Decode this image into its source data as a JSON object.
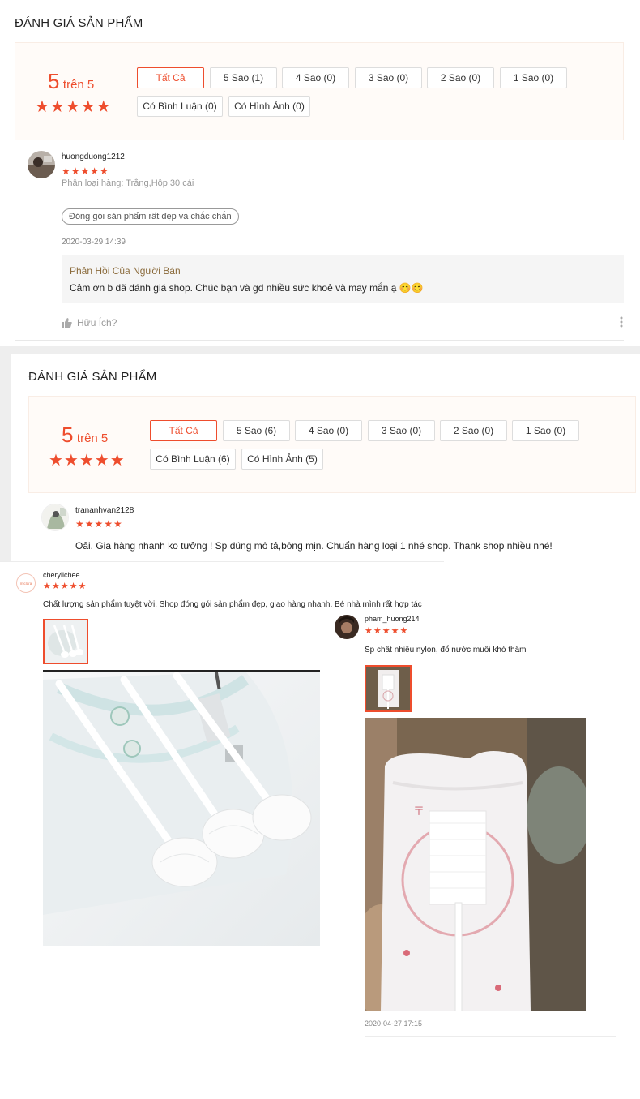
{
  "block1": {
    "title": "ĐÁNH GIÁ SẢN PHẨM",
    "score_value": "5",
    "score_suffix": "trên 5",
    "stars": "★★★★★",
    "filters": [
      "Tất Cả",
      "5 Sao (1)",
      "4 Sao (0)",
      "3 Sao (0)",
      "2 Sao (0)",
      "1 Sao (0)",
      "Có Bình Luận (0)",
      "Có Hình Ảnh (0)"
    ],
    "review": {
      "username": "huongduong1212",
      "stars": "★★★★★",
      "variant": "Phân loại hàng: Trắng,Hộp 30 cái",
      "tag": "Đóng gói sản phẩm rất đẹp và chắc chắn",
      "date": "2020-03-29 14:39",
      "reply_title": "Phản Hồi Của Người Bán",
      "reply_text": "Cảm ơn b đã đánh giá shop. Chúc bạn và gđ nhiều sức khoẻ và may mắn ạ 😊😊",
      "helpful": "Hữu Ích?"
    }
  },
  "block2": {
    "title": "ĐÁNH GIÁ SẢN PHẨM",
    "score_value": "5",
    "score_suffix": "trên 5",
    "stars": "★★★★★",
    "filters": [
      "Tất Cả",
      "5 Sao (6)",
      "4 Sao (0)",
      "3 Sao (0)",
      "2 Sao (0)",
      "1 Sao (0)",
      "Có Bình Luận (6)",
      "Có Hình Ảnh (5)"
    ],
    "review": {
      "username": "trananhvan2128",
      "stars": "★★★★★",
      "comment": "Oải. Gia hàng nhanh ko tưởng ! Sp đúng mô tả,bông mịn. Chuẩn hàng loại 1 nhé shop. Thank shop nhiều nhé!"
    }
  },
  "block3": {
    "username": "cherylichee",
    "stars": "★★★★★",
    "comment": "Chất lượng sản phẩm tuyệt vời. Shop đóng gói sản phẩm đẹp, giao hàng nhanh. Bé nhà mình rất hợp tác",
    "avatar_text": "miclara"
  },
  "block4": {
    "username": "pham_huong214",
    "stars": "★★★★★",
    "comment": "Sp chất nhiều nylon, đổ nước muối khó thấm",
    "date": "2020-04-27 17:15"
  },
  "colors": {
    "accent": "#ee4d2d",
    "overview_bg": "#fffbf8"
  }
}
